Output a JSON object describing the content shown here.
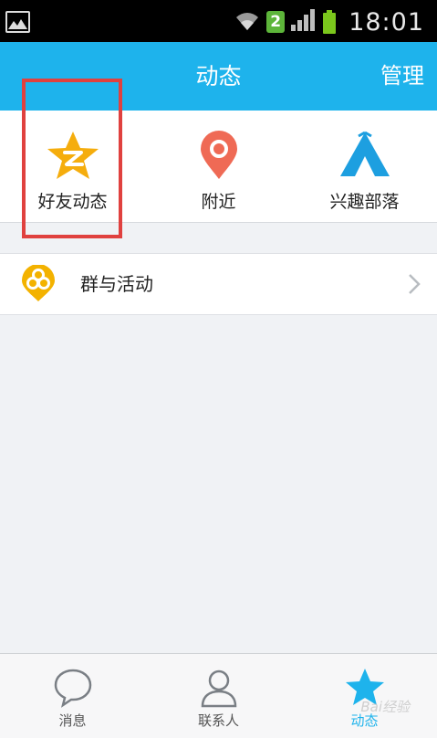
{
  "status_bar": {
    "sim_number": "2",
    "time": "18:01"
  },
  "header": {
    "title": "动态",
    "manage_label": "管理"
  },
  "features": [
    {
      "label": "好友动态",
      "icon": "qzone-star-icon"
    },
    {
      "label": "附近",
      "icon": "location-pin-icon"
    },
    {
      "label": "兴趣部落",
      "icon": "tribe-tent-icon"
    }
  ],
  "list": {
    "items": [
      {
        "label": "群与活动",
        "icon": "group-activity-icon"
      }
    ]
  },
  "tabs": [
    {
      "label": "消息",
      "icon": "chat-bubble-icon",
      "active": false
    },
    {
      "label": "联系人",
      "icon": "contacts-person-icon",
      "active": false
    },
    {
      "label": "动态",
      "icon": "star-icon",
      "active": true
    }
  ],
  "colors": {
    "accent": "#1eb3ec",
    "highlight": "#e0413f",
    "qzone_star": "#f5ad0d",
    "pin": "#ef6a55",
    "tent": "#1d9fe0",
    "group_icon": "#f3b200"
  },
  "watermark": "Bai经验"
}
